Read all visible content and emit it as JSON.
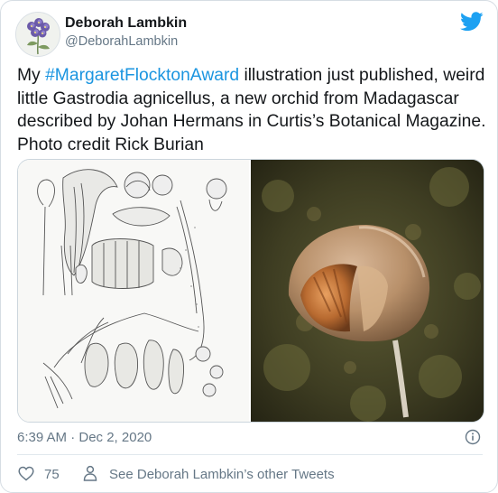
{
  "author": {
    "name": "Deborah Lambkin",
    "handle": "@DeborahLambkin"
  },
  "tweet": {
    "prefix": "My ",
    "hashtag": "#MargaretFlocktonAward",
    "body": " illustration just published, weird little Gastrodia agnicellus, a new orchid from Madagascar described by Johan Hermans in Curtis’s Botanical Magazine. Photo credit Rick Burian"
  },
  "meta": {
    "timestamp": "6:39 AM · Dec 2, 2020"
  },
  "actions": {
    "like_count": "75",
    "see_tweets_label": "See Deborah Lambkin’s other Tweets"
  },
  "colors": {
    "link": "#1b95e0",
    "secondary_text": "#657786",
    "primary_text": "#14171a"
  },
  "icons": [
    "twitter-bird-icon",
    "info-icon",
    "heart-icon",
    "person-icon"
  ]
}
